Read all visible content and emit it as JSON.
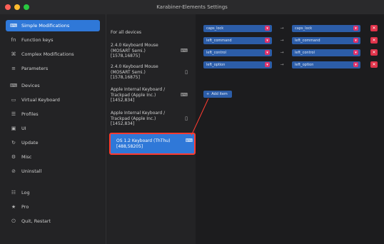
{
  "window": {
    "title": "Karabiner-Elements Settings",
    "traffic_colors": [
      "#ff5f57",
      "#febc2e",
      "#28c840"
    ]
  },
  "sidebar": {
    "items": [
      {
        "label": "Simple Modifications",
        "icon": "key-icon",
        "glyph": "⌨",
        "active": true
      },
      {
        "label": "Function keys",
        "icon": "fn-key-icon",
        "glyph": "fn",
        "active": false
      },
      {
        "label": "Complex Modifications",
        "icon": "complex-icon",
        "glyph": "⌘",
        "active": false
      },
      {
        "label": "Parameters",
        "icon": "sliders-icon",
        "glyph": "≡",
        "active": false
      },
      {
        "label": "Devices",
        "icon": "keyboard-icon",
        "glyph": "⌨",
        "active": false
      },
      {
        "label": "Virtual Keyboard",
        "icon": "virtual-keyboard-icon",
        "glyph": "▭",
        "active": false
      },
      {
        "label": "Profiles",
        "icon": "profiles-icon",
        "glyph": "☰",
        "active": false
      },
      {
        "label": "UI",
        "icon": "ui-icon",
        "glyph": "▣",
        "active": false
      },
      {
        "label": "Update",
        "icon": "update-icon",
        "glyph": "↻",
        "active": false
      },
      {
        "label": "Misc",
        "icon": "misc-icon",
        "glyph": "⚙",
        "active": false
      },
      {
        "label": "Uninstall",
        "icon": "uninstall-icon",
        "glyph": "⊘",
        "active": false
      },
      {
        "label": "Log",
        "icon": "log-icon",
        "glyph": "☷",
        "active": false
      },
      {
        "label": "Pro",
        "icon": "pro-icon",
        "glyph": "★",
        "active": false
      },
      {
        "label": "Quit, Restart",
        "icon": "power-icon",
        "glyph": "⏻",
        "active": false
      }
    ]
  },
  "devices": {
    "header": "For all devices",
    "list": [
      {
        "lines": [
          "2.4.0 Keyboard Mouse",
          "(MOSART Semi.)",
          "[1578,16875]"
        ],
        "icon": "keyboard-icon",
        "selected": false
      },
      {
        "lines": [
          "2.4.0 Keyboard Mouse",
          "(MOSART Semi.)",
          "[1578,16875]"
        ],
        "icon": "mouse-icon",
        "selected": false
      },
      {
        "lines": [
          "Apple Internal Keyboard /",
          "Trackpad (Apple Inc.)",
          "[1452,834]"
        ],
        "icon": "keyboard-icon",
        "selected": false
      },
      {
        "lines": [
          "Apple Internal Keyboard /",
          "Trackpad (Apple Inc.)",
          "[1452,834]"
        ],
        "icon": "mouse-icon",
        "selected": false
      },
      {
        "lines": [
          "OS 1.2 Keyboard (ThThu)",
          "[488,58205]"
        ],
        "icon": "keyboard-icon",
        "selected": true
      }
    ]
  },
  "mappings": {
    "rows": [
      {
        "from": "caps_lock",
        "to": "caps_lock"
      },
      {
        "from": "left_command",
        "to": "left_command"
      },
      {
        "from": "left_control",
        "to": "left_control"
      },
      {
        "from": "left_option",
        "to": "left_option"
      }
    ],
    "arrow": "→",
    "delete_glyph": "✕",
    "add_label": "Add item",
    "add_glyph": "+",
    "caret_glyph": "▾"
  },
  "colors": {
    "accent": "#2f78d8",
    "selection_outline": "#ff3b30",
    "select_bg": "#2c5da8",
    "delete_bg": "#e0334a"
  }
}
